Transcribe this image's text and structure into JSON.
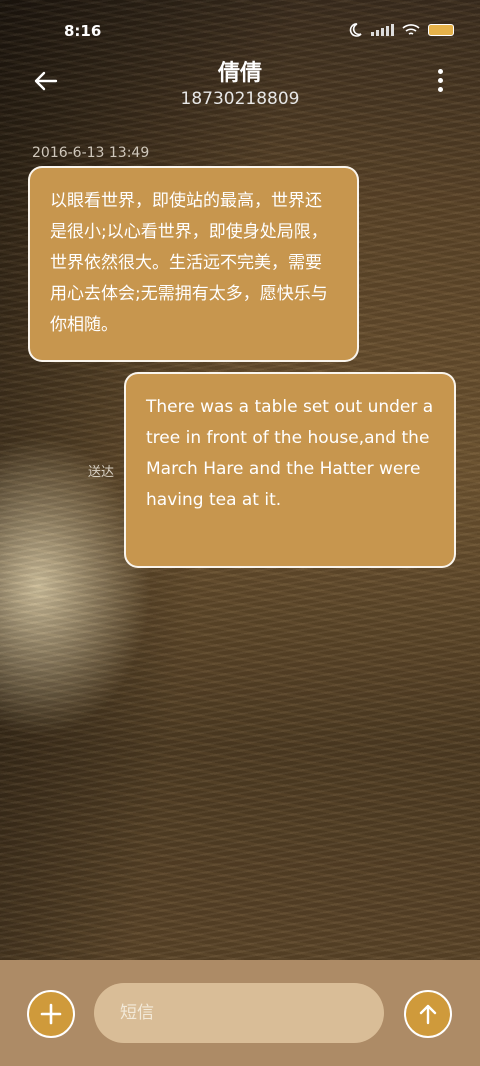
{
  "status_bar": {
    "time": "8:16"
  },
  "header": {
    "title": "倩倩",
    "subtitle": "18730218809"
  },
  "messages": [
    {
      "timestamp": "2016-6-13 13:49",
      "text": "以眼看世界，即使站的最高，世界还是很小;以心看世界，即使身处局限，世界依然很大。生活远不完美，需要用心去体会;无需拥有太多，愿快乐与你相随。",
      "direction": "incoming"
    },
    {
      "text": "There was a table set out under a tree in front of the house,and the March Hare and the Hatter were having tea at it.",
      "direction": "outgoing",
      "status": "送达"
    }
  ],
  "composer": {
    "placeholder": "短信",
    "value": ""
  },
  "icons": {
    "back": "back-arrow-icon",
    "menu": "more-vertical-icon",
    "add": "plus-icon",
    "send": "arrow-up-icon"
  },
  "colors": {
    "bubble": "#c7964e",
    "composer_bg": "#ad8b66",
    "button": "#cf9a3b",
    "input_bg": "#d9bd97"
  }
}
